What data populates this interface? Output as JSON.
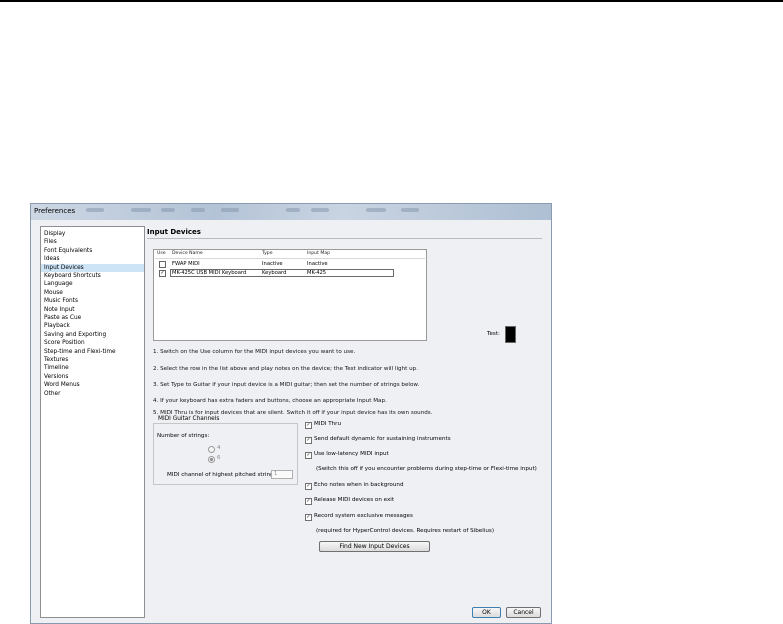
{
  "window": {
    "title": "Preferences"
  },
  "sidebar": {
    "items": [
      {
        "label": "Display",
        "selected": false
      },
      {
        "label": "Files",
        "selected": false
      },
      {
        "label": "Font Equivalents",
        "selected": false
      },
      {
        "label": "Ideas",
        "selected": false
      },
      {
        "label": "Input Devices",
        "selected": true
      },
      {
        "label": "Keyboard Shortcuts",
        "selected": false
      },
      {
        "label": "Language",
        "selected": false
      },
      {
        "label": "Mouse",
        "selected": false
      },
      {
        "label": "Music Fonts",
        "selected": false
      },
      {
        "label": "Note Input",
        "selected": false
      },
      {
        "label": "Paste as Cue",
        "selected": false
      },
      {
        "label": "Playback",
        "selected": false
      },
      {
        "label": "Saving and Exporting",
        "selected": false
      },
      {
        "label": "Score Position",
        "selected": false
      },
      {
        "label": "Step-time and Flexi-time",
        "selected": false
      },
      {
        "label": "Textures",
        "selected": false
      },
      {
        "label": "Timeline",
        "selected": false
      },
      {
        "label": "Versions",
        "selected": false
      },
      {
        "label": "Word Menus",
        "selected": false
      },
      {
        "label": "Other",
        "selected": false
      }
    ]
  },
  "page": {
    "title": "Input Devices"
  },
  "device_table": {
    "columns": [
      "Use",
      "Device Name",
      "Type",
      "Input Map"
    ],
    "rows": [
      {
        "use": "",
        "name": "FWAP MIDI",
        "type": "Inactive",
        "map": "Inactive"
      },
      {
        "use": "✓",
        "name": "MK-425C USB MIDI Keyboard",
        "type": "Keyboard",
        "map": "MK-425"
      }
    ]
  },
  "test": {
    "label": "Test:"
  },
  "instructions": [
    "1. Switch on the Use column for the MIDI input devices you want to use.",
    "2. Select the row in the list above and play notes on the device; the Test indicator will light up.",
    "3. Set Type to Guitar if your input device is a MIDI guitar; then set the number of strings below.",
    "4. If your keyboard has extra faders and buttons, choose an appropriate Input Map.",
    "5. MIDI Thru is for input devices that are silent. Switch it off if your input device has its own sounds."
  ],
  "guitar": {
    "group_label": "MIDI Guitar Channels",
    "strings_label": "Number of strings:",
    "option_4": "4",
    "option_6": "6",
    "highest_label": "MIDI channel of highest pitched string:",
    "highest_value": "1"
  },
  "options": {
    "midi_thru": "MIDI Thru",
    "send_default": "Send default dynamic for sustaining instruments",
    "low_latency": "Use low-latency MIDI input",
    "low_latency_note": "(Switch this off if you encounter problems during step-time or Flexi-time input)",
    "echo": "Echo notes when in background",
    "release": "Release MIDI devices on exit",
    "sysex": "Record system exclusive messages",
    "sysex_note": "(required for HyperControl devices. Requires restart of Sibelius)",
    "check_mark": "✓"
  },
  "buttons": {
    "find": "Find New Input Devices",
    "ok": "OK",
    "cancel": "Cancel"
  }
}
